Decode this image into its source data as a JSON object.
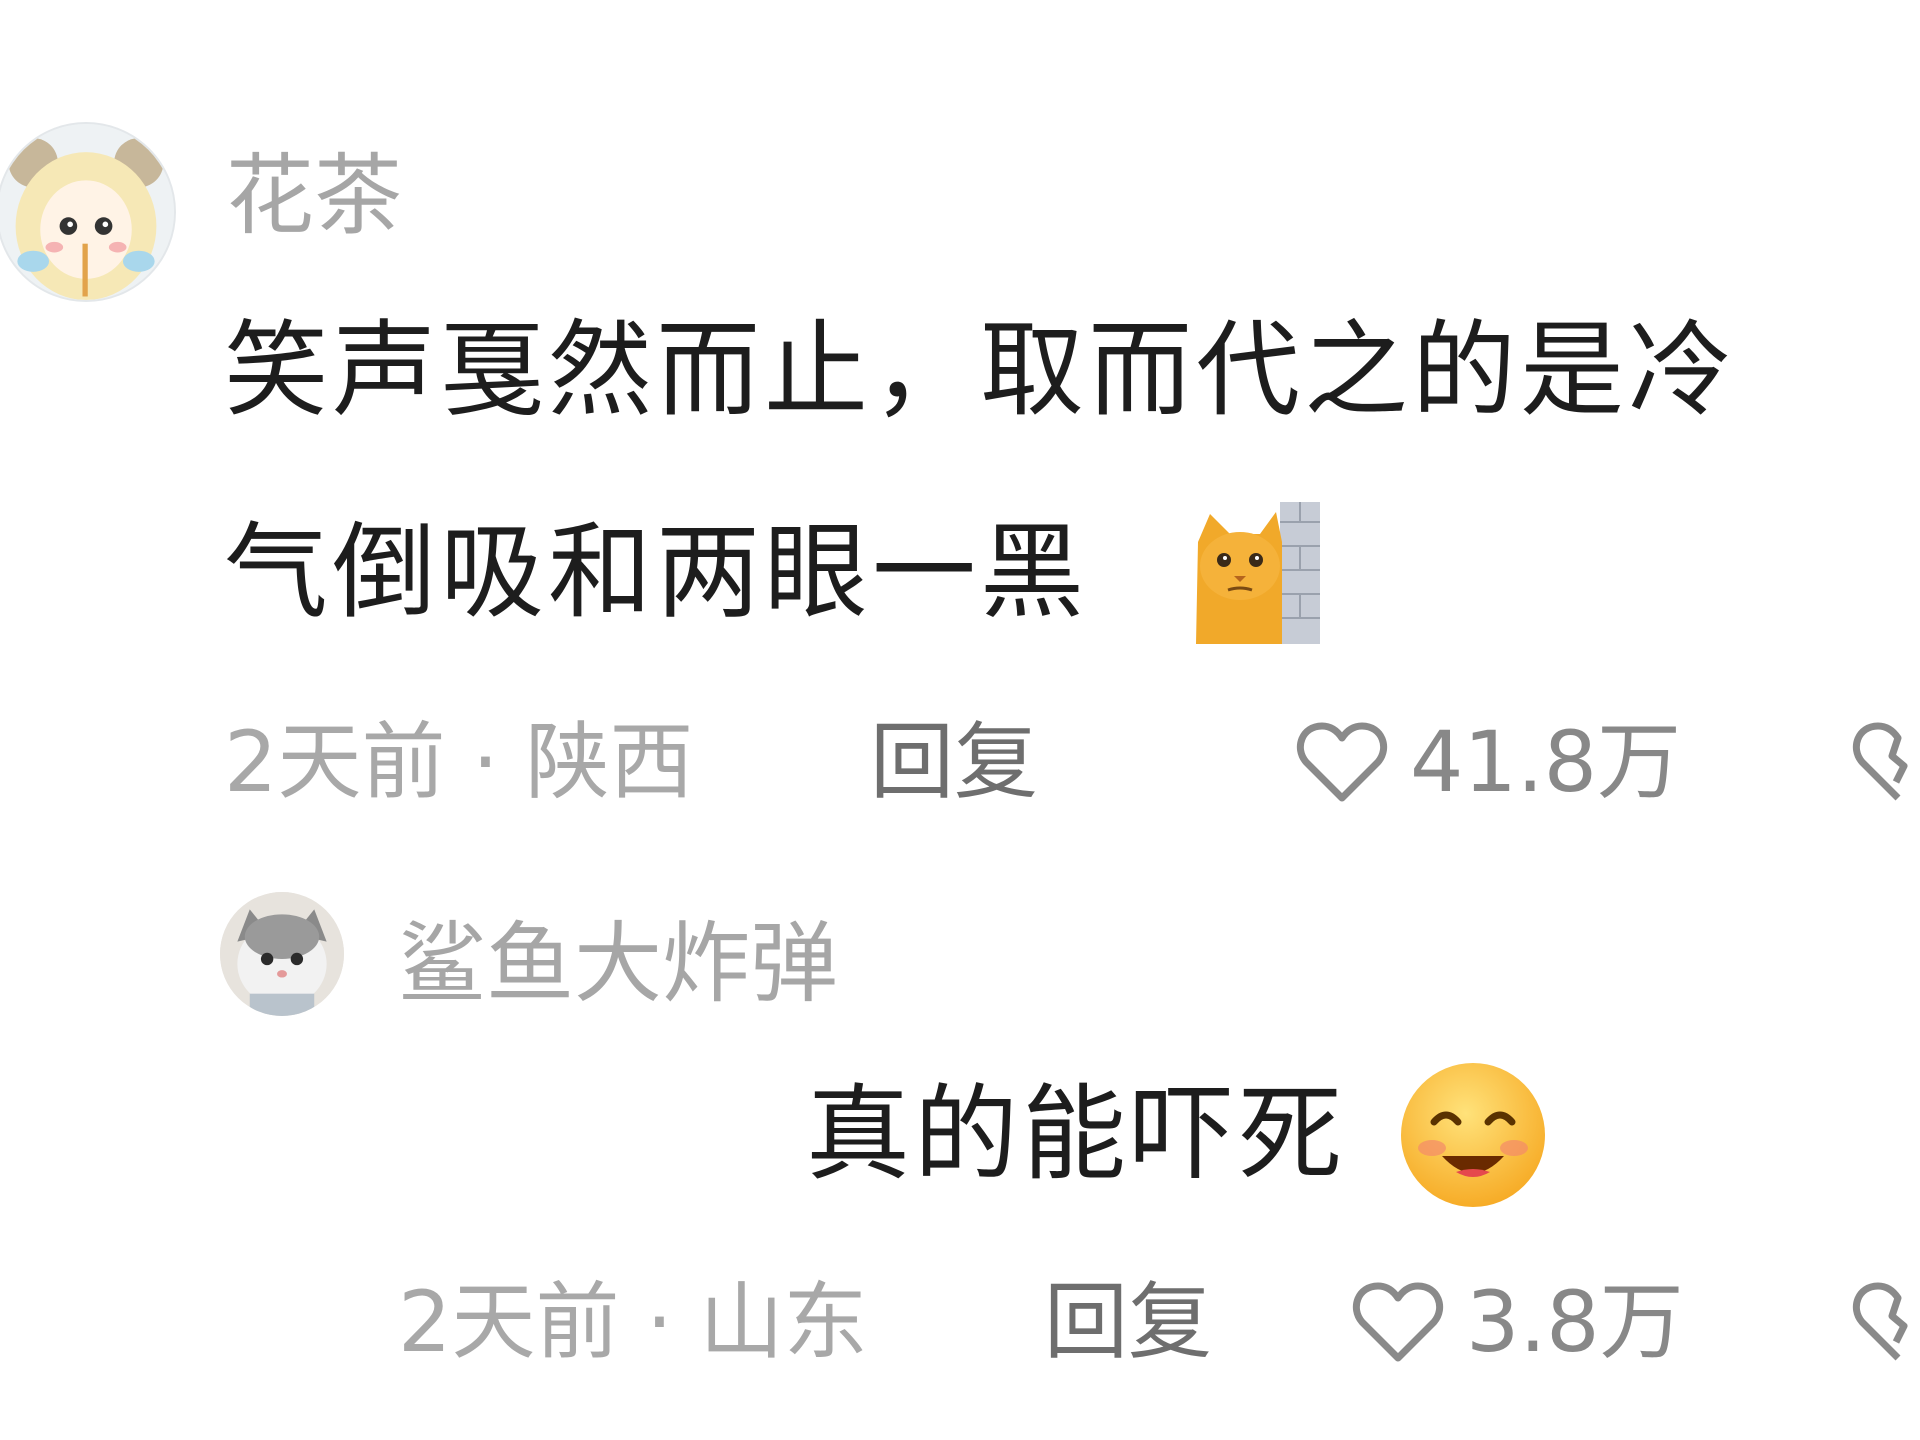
{
  "comment": {
    "author": "花茶",
    "text_line1": "笑声戛然而止，取而代之的是冷",
    "text_line2": "气倒吸和两眼一黑",
    "time_location": "2天前 · 陕西",
    "reply_label": "回复",
    "likes": "41.8万",
    "emoji": "cat-behind-wall"
  },
  "reply": {
    "author": "鲨鱼大炸弹",
    "text": "真的能吓死",
    "time_location": "2天前 · 山东",
    "reply_label": "回复",
    "likes": "3.8万",
    "emoji": "smiling-face"
  },
  "icons": [
    "heart-outline-icon",
    "heart-broken-icon"
  ],
  "colors": {
    "username": "#a6a6a6",
    "text": "#1d1d1d",
    "meta": "#a8a8a8",
    "reply": "#6e6e6e"
  }
}
